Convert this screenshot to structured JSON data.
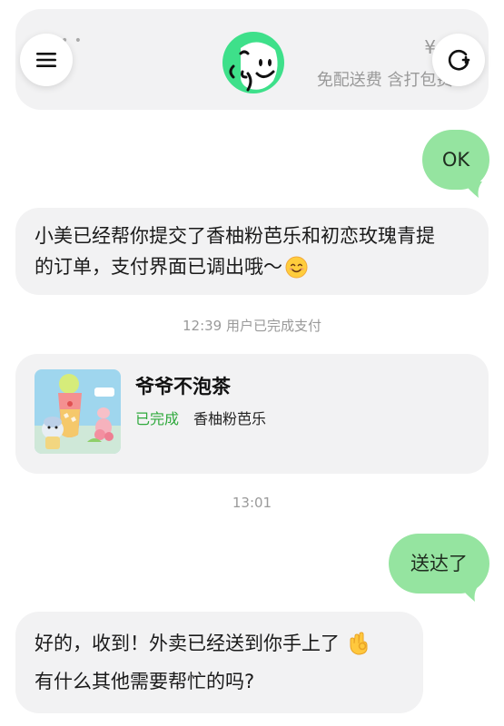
{
  "header": {
    "top_price_symbol": "¥",
    "delivery_text": "免配送费 含打包费",
    "delivery_price_symbol": "¥",
    "dots": "• •"
  },
  "messages": {
    "user_ok": "OK",
    "bot_order_line1": "小美已经帮你提交了香柚粉芭乐和初恋玫瑰青提",
    "bot_order_line2": "的订单，支付界面已调出哦～",
    "payment_notice": "12:39 用户已完成支付",
    "time_1301": "13:01",
    "user_delivered": "送达了",
    "bot_reply_line1": "好的，收到！外卖已经送到你手上了",
    "bot_reply_line2": "有什么其他需要帮忙的吗?"
  },
  "order": {
    "store_name": "爷爷不泡茶",
    "status": "已完成",
    "item": "香柚粉芭乐",
    "status_color": "#2fa93c"
  },
  "colors": {
    "user_bubble": "#95e4a0",
    "bot_bubble": "#f2f2f3",
    "avatar_green": "#3ee08a"
  },
  "icons": {
    "menu": "menu-icon",
    "new_chat": "new-chat-icon",
    "smile_emoji": "smiling-face-emoji-icon",
    "ok_hand_emoji": "ok-hand-emoji-icon"
  }
}
